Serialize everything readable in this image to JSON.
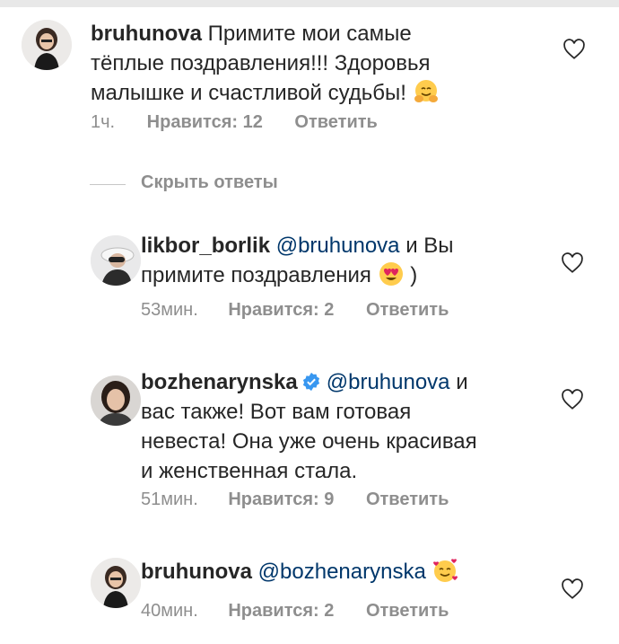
{
  "comments": [
    {
      "username": "bruhunova",
      "text_1": "Примите мои самые",
      "text_2": "тёплые поздравления!!! Здоровья",
      "text_3": "малышке и счастливой судьбы!",
      "emoji": "hugging-face",
      "time": "1ч.",
      "likes": "Нравится: 12",
      "reply": "Ответить"
    }
  ],
  "hide_replies": "Скрыть ответы",
  "replies": [
    {
      "username": "likbor_borlik",
      "mention": "@bruhunova",
      "text_1": "и Вы",
      "text_2": "примите поздравления",
      "emoji": "heart-eyes",
      "text_after_emoji": ")",
      "time": "53мин.",
      "likes": "Нравится: 2",
      "reply": "Ответить"
    },
    {
      "username": "bozhenarynska",
      "verified": true,
      "mention": "@bruhunova",
      "text_1": "и",
      "text_2": "вас также! Вот вам готовая",
      "text_3": "невеста! Она уже очень красивая",
      "text_4": "и женственная стала.",
      "time": "51мин.",
      "likes": "Нравится: 9",
      "reply": "Ответить"
    },
    {
      "username": "bruhunova",
      "mention": "@bozhenarynska",
      "emoji": "smiling-face-with-hearts",
      "time": "40мин.",
      "likes": "Нравится: 2",
      "reply": "Ответить"
    }
  ],
  "colors": {
    "text": "#262626",
    "meta": "#8e8e8e",
    "mention": "#00376b",
    "verified": "#3897f0"
  }
}
